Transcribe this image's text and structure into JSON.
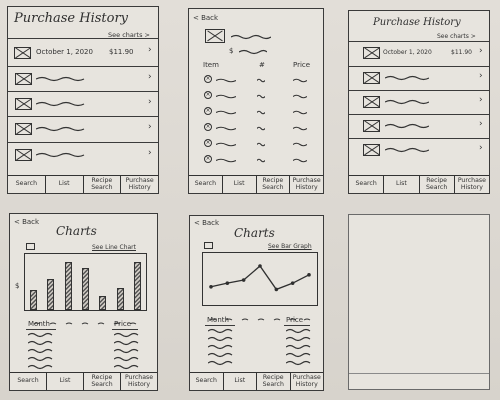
{
  "tabs": [
    "Search",
    "List",
    "Recipe\nSearch",
    "Purchase\nHistory"
  ],
  "purchase_history": {
    "title": "Purchase History",
    "see_charts": "See charts >",
    "first_item": {
      "date": "October 1, 2020",
      "price": "$11.90"
    }
  },
  "detail": {
    "back": "< Back",
    "price_symbol": "$",
    "col_item": "Item",
    "col_count": "#",
    "col_price": "Price"
  },
  "bar_chart_screen": {
    "back": "< Back",
    "title": "Charts",
    "link": "See Line Chart",
    "y_symbol": "$",
    "col_month": "Month",
    "col_price": "Price"
  },
  "line_chart_screen": {
    "back": "< Back",
    "title": "Charts",
    "link": "See Bar Graph",
    "col_month": "Month",
    "col_price": "Price"
  },
  "chart_data": [
    {
      "type": "bar",
      "values": [
        0.35,
        0.55,
        0.85,
        0.75,
        0.25,
        0.4,
        0.85
      ],
      "title": "",
      "xlabel": "",
      "ylabel": "$"
    },
    {
      "type": "line",
      "values": [
        0.35,
        0.42,
        0.48,
        0.75,
        0.3,
        0.42,
        0.58
      ],
      "title": "",
      "xlabel": "",
      "ylabel": ""
    }
  ]
}
